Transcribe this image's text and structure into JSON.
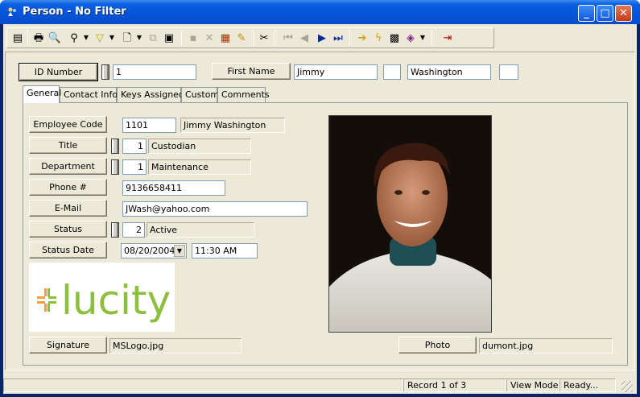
{
  "window": {
    "title": "Person - No Filter",
    "controls": [
      "minimize",
      "maximize",
      "close"
    ]
  },
  "toolbar": {
    "icons": [
      "list-icon",
      "print-icon",
      "print-preview-icon",
      "query-icon",
      "filter-icon",
      "new-record-icon",
      "copy-record-icon",
      "view-icon",
      "save-icon",
      "delete-icon",
      "books-icon",
      "edit-icon",
      "cut-icon",
      "first-record-icon",
      "previous-record-icon",
      "next-record-icon",
      "last-record-icon",
      "goto-icon",
      "lightning-icon",
      "report-icon",
      "book-icon",
      "exit-icon"
    ]
  },
  "header": {
    "id_label": "ID Number",
    "id_value": "1",
    "name_label": "First Name",
    "first_name": "Jimmy",
    "middle_name": "",
    "last_name": "Washington",
    "suffix": ""
  },
  "tabs": [
    {
      "label": "General",
      "active": true
    },
    {
      "label": "Contact Info"
    },
    {
      "label": "Keys Assigned"
    },
    {
      "label": "Custom"
    },
    {
      "label": "Comments"
    }
  ],
  "general": {
    "employee_code": {
      "label": "Employee Code",
      "value": "1101",
      "display": "Jimmy Washington"
    },
    "title": {
      "label": "Title",
      "code": "1",
      "value": "Custodian"
    },
    "department": {
      "label": "Department",
      "code": "1",
      "value": "Maintenance"
    },
    "phone": {
      "label": "Phone #",
      "value": "9136658411"
    },
    "email": {
      "label": "E-Mail",
      "value": "JWash@yahoo.com"
    },
    "status": {
      "label": "Status",
      "code": "2",
      "value": "Active"
    },
    "status_date": {
      "label": "Status Date",
      "date": "08/20/2004",
      "time": "11:30 AM"
    },
    "logo_text": "lucity",
    "signature": {
      "label": "Signature",
      "value": "MSLogo.jpg"
    },
    "photo": {
      "label": "Photo",
      "value": "dumont.jpg"
    }
  },
  "status_bar": {
    "record": "Record 1 of 3",
    "mode": "View Mode",
    "state": "Ready..."
  },
  "colors": {
    "titlebar": "#0654d8",
    "face": "#ece9d8",
    "logo_green": "#8dbf3f",
    "logo_orange": "#f2a03a"
  }
}
